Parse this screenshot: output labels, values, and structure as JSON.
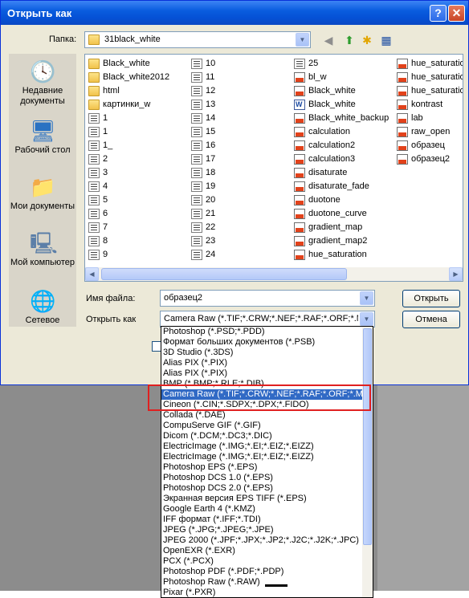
{
  "window": {
    "title": "Открыть как",
    "help_label": "?",
    "close_label": "✕"
  },
  "lookin": {
    "label": "Папка:",
    "value": "31black_white"
  },
  "places": [
    {
      "label": "Недавние документы"
    },
    {
      "label": "Рабочий стол"
    },
    {
      "label": "Мои документы"
    },
    {
      "label": "Мой компьютер"
    },
    {
      "label": "Сетевое"
    }
  ],
  "files": {
    "col1": [
      {
        "name": "Black_white",
        "icon": "folder-icon"
      },
      {
        "name": "Black_white2012",
        "icon": "folder-icon"
      },
      {
        "name": "html",
        "icon": "folder-icon"
      },
      {
        "name": "картинки_w",
        "icon": "folder-icon"
      },
      {
        "name": "1",
        "icon": "psd-icon"
      },
      {
        "name": "1",
        "icon": "psd-icon"
      },
      {
        "name": "1_",
        "icon": "psd-icon"
      },
      {
        "name": "2",
        "icon": "psd-icon"
      },
      {
        "name": "3",
        "icon": "psd-icon"
      },
      {
        "name": "4",
        "icon": "psd-icon"
      },
      {
        "name": "5",
        "icon": "psd-icon"
      },
      {
        "name": "6",
        "icon": "psd-icon"
      },
      {
        "name": "7",
        "icon": "psd-icon"
      },
      {
        "name": "8",
        "icon": "psd-icon"
      },
      {
        "name": "9",
        "icon": "psd-icon"
      }
    ],
    "col2": [
      {
        "name": "10",
        "icon": "psd-icon"
      },
      {
        "name": "11",
        "icon": "psd-icon"
      },
      {
        "name": "12",
        "icon": "psd-icon"
      },
      {
        "name": "13",
        "icon": "psd-icon"
      },
      {
        "name": "14",
        "icon": "psd-icon"
      },
      {
        "name": "15",
        "icon": "psd-icon"
      },
      {
        "name": "16",
        "icon": "psd-icon"
      },
      {
        "name": "17",
        "icon": "psd-icon"
      },
      {
        "name": "18",
        "icon": "psd-icon"
      },
      {
        "name": "19",
        "icon": "psd-icon"
      },
      {
        "name": "20",
        "icon": "psd-icon"
      },
      {
        "name": "21",
        "icon": "psd-icon"
      },
      {
        "name": "22",
        "icon": "psd-icon"
      },
      {
        "name": "23",
        "icon": "psd-icon"
      },
      {
        "name": "24",
        "icon": "psd-icon"
      }
    ],
    "col3": [
      {
        "name": "25",
        "icon": "psd-icon"
      },
      {
        "name": "bl_w",
        "icon": "atn-icon"
      },
      {
        "name": "Black_white",
        "icon": "atn-icon"
      },
      {
        "name": "Black_white",
        "icon": "doc-icon"
      },
      {
        "name": "Black_white_backup",
        "icon": "atn-icon"
      },
      {
        "name": "calculation",
        "icon": "atn-icon"
      },
      {
        "name": "calculation2",
        "icon": "atn-icon"
      },
      {
        "name": "calculation3",
        "icon": "atn-icon"
      },
      {
        "name": "disaturate",
        "icon": "atn-icon"
      },
      {
        "name": "disaturate_fade",
        "icon": "atn-icon"
      },
      {
        "name": "duotone",
        "icon": "atn-icon"
      },
      {
        "name": "duotone_curve",
        "icon": "atn-icon"
      },
      {
        "name": "gradient_map",
        "icon": "atn-icon"
      },
      {
        "name": "gradient_map2",
        "icon": "atn-icon"
      },
      {
        "name": "hue_saturation",
        "icon": "atn-icon"
      }
    ],
    "col4": [
      {
        "name": "hue_saturatio",
        "icon": "atn-icon"
      },
      {
        "name": "hue_saturatio",
        "icon": "atn-icon"
      },
      {
        "name": "hue_saturatio",
        "icon": "atn-icon"
      },
      {
        "name": "kontrast",
        "icon": "atn-icon"
      },
      {
        "name": "lab",
        "icon": "atn-icon"
      },
      {
        "name": "raw_open",
        "icon": "atn-icon"
      },
      {
        "name": "образец",
        "icon": "atn-icon"
      },
      {
        "name": "образец2",
        "icon": "atn-icon"
      }
    ]
  },
  "filename": {
    "label": "Имя файла:",
    "value": "образец2"
  },
  "filetype": {
    "label": "Открыть как",
    "value": "Camera Raw (*.TIF;*.CRW;*.NEF;*.RAF;*.ORF;*.MR"
  },
  "buttons": {
    "open": "Открыть",
    "cancel": "Отмена"
  },
  "dropdown_items": [
    "Photoshop (*.PSD;*.PDD)",
    "Формат больших документов (*.PSB)",
    "3D Studio (*.3DS)",
    "Alias PIX (*.PIX)",
    "Alias PIX (*.PIX)",
    "BMP (*.BMP;*.RLE;*.DIB)",
    "Camera Raw (*.TIF;*.CRW;*.NEF;*.RAF;*.ORF;*.MR",
    "Cineon (*.CIN;*.SDPX;*.DPX;*.FIDO)",
    "Collada (*.DAE)",
    "CompuServe GIF (*.GIF)",
    "Dicom (*.DCM;*.DC3;*.DIC)",
    "ElectricImage (*.IMG;*.EI;*.EIZ;*.EIZZ)",
    "ElectricImage (*.IMG;*.EI;*.EIZ;*.EIZZ)",
    "Photoshop EPS (*.EPS)",
    "Photoshop DCS 1.0 (*.EPS)",
    "Photoshop DCS 2.0 (*.EPS)",
    "Экранная версия EPS TIFF (*.EPS)",
    "Google Earth 4 (*.KMZ)",
    "IFF формат (*.IFF;*.TDI)",
    "JPEG (*.JPG;*.JPEG;*.JPE)",
    "JPEG 2000 (*.JPF;*.JPX;*.JP2;*.J2C;*.J2K;*.JPC)",
    "OpenEXR (*.EXR)",
    "PCX (*.PCX)",
    "Photoshop PDF (*.PDF;*.PDP)",
    "Photoshop Raw (*.RAW)",
    "Pixar (*.PXR)"
  ],
  "selected_index": 6,
  "colors": {
    "selection": "#316ac5",
    "highlight_box": "#e02020",
    "titlebar": "#0a5ddf"
  }
}
